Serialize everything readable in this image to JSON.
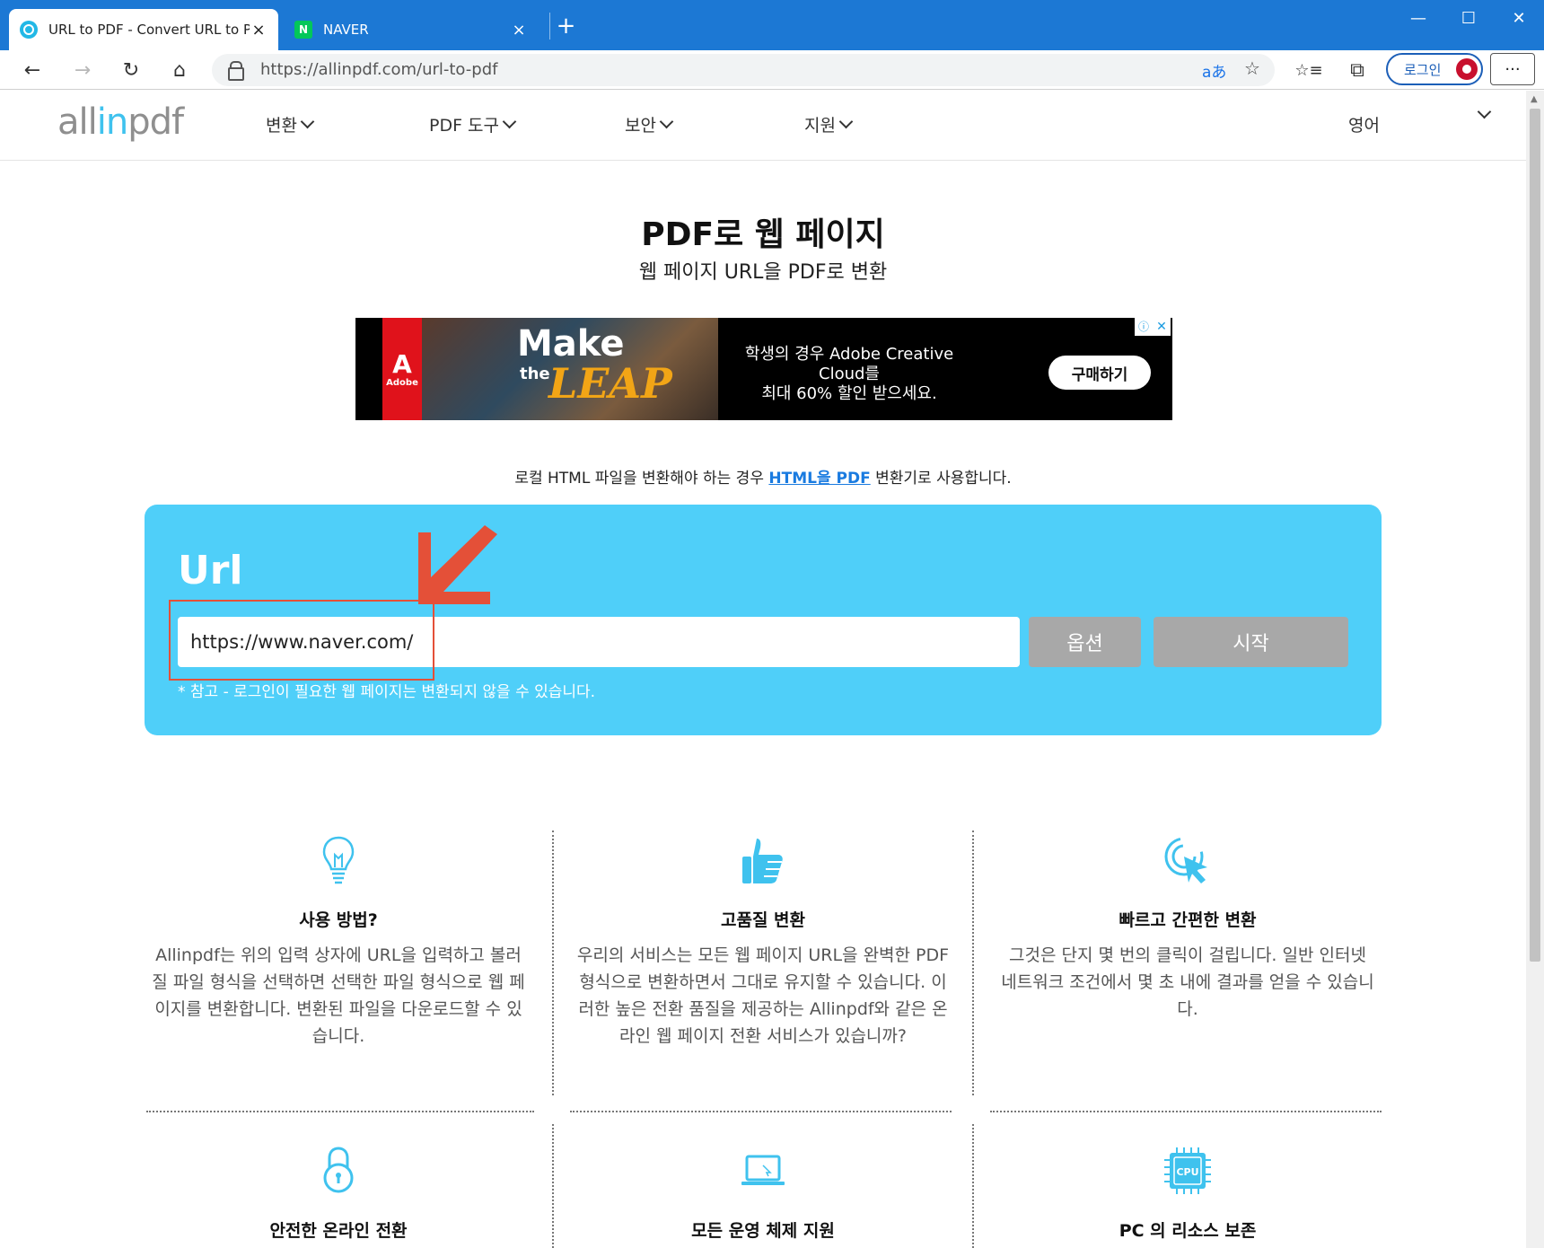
{
  "browser": {
    "tabs": [
      {
        "title": "URL to PDF - Convert URL to PDF",
        "favicon": "allinpdf-icon"
      },
      {
        "title": "NAVER",
        "favicon": "naver-icon",
        "favicon_letter": "N"
      }
    ],
    "close_glyph": "×",
    "new_tab_glyph": "+",
    "window_controls": {
      "minimize": "—",
      "maximize": "☐",
      "close": "✕"
    },
    "nav": {
      "back": "←",
      "forward": "→",
      "reload": "↻",
      "home": "⌂"
    },
    "address": "https://allinpdf.com/url-to-pdf",
    "read_aloud": "aあ",
    "add_favorite": "☆",
    "favorites": "☆≡",
    "collections": "⧉",
    "login_label": "로그인",
    "more": "···"
  },
  "site": {
    "logo_pre": "all",
    "logo_in": "in",
    "logo_post": "pdf",
    "menu": [
      {
        "label": "변환"
      },
      {
        "label": "PDF 도구"
      },
      {
        "label": "보안"
      },
      {
        "label": "지원"
      }
    ],
    "language": "영어"
  },
  "main": {
    "title": "PDF로 웹 페이지",
    "subtitle": "웹 페이지 URL을 PDF로 변환",
    "ad": {
      "brand": "Adobe",
      "brand_glyph": "A",
      "make": "Make",
      "the": "the",
      "leap": "LEAP",
      "line1": "학생의 경우 Adobe Creative Cloud를",
      "line2": "최대 60% 할인 받으세요.",
      "button": "구매하기",
      "info": "ⓘ",
      "close": "✕"
    },
    "note_pre": "로컬 HTML 파일을 변환해야 하는 경우 ",
    "note_link": "HTML을 PDF",
    "note_post": " 변환기로 사용합니다.",
    "panel": {
      "label": "Url",
      "url_value": "https://www.naver.com/",
      "options_button": "옵션",
      "start_button": "시작",
      "hint": "* 참고 - 로그인이 필요한 웹 페이지는 변환되지 않을 수 있습니다."
    }
  },
  "features": [
    {
      "icon": "lightbulb-icon",
      "title": "사용 방법?",
      "desc": "Allinpdf는 위의 입력 상자에 URL을 입력하고 볼러질 파일 형식을 선택하면 선택한 파일 형식으로 웹 페이지를 변환합니다. 변환된 파일을 다운로드할 수 있습니다."
    },
    {
      "icon": "thumbs-up-icon",
      "title": "고품질 변환",
      "desc": "우리의 서비스는 모든 웹 페이지 URL을 완벽한 PDF 형식으로 변환하면서 그대로 유지할 수 있습니다. 이러한 높은 전환 품질을 제공하는 Allinpdf와 같은 온라인 웹 페이지 전환 서비스가 있습니까?"
    },
    {
      "icon": "click-pointer-icon",
      "title": "빠르고 간편한 변환",
      "desc": "그것은 단지 몇 번의 클릭이 걸립니다. 일반 인터넷 네트워크 조건에서 몇 초 내에 결과를 얻을 수 있습니다."
    },
    {
      "icon": "padlock-icon",
      "title": "안전한 온라인 전환",
      "desc": ""
    },
    {
      "icon": "laptop-icon",
      "title": "모든 운영 체제 지원",
      "desc": ""
    },
    {
      "icon": "cpu-icon",
      "title": "PC 의 리소스 보존",
      "cpu_label": "CPU",
      "desc": ""
    }
  ],
  "colors": {
    "browser_accent": "#1c78d4",
    "panel_bg": "#4fcff9",
    "logo_accent": "#3fc2ee",
    "icon_blue": "#3fc2ee",
    "button_gray": "#a8a8a8",
    "highlight_red": "#e45038",
    "link": "#1a7be0"
  }
}
